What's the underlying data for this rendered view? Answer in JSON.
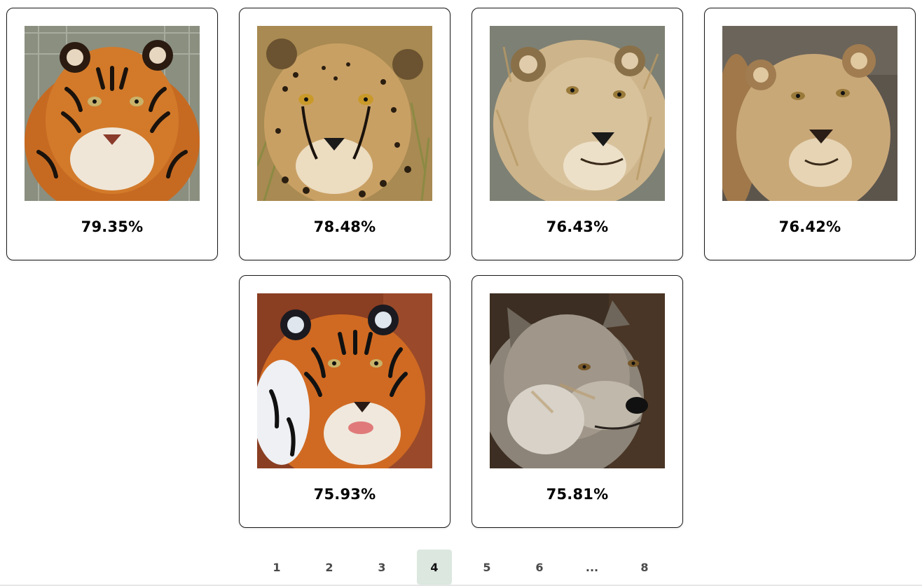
{
  "results": [
    {
      "animal": "tiger",
      "score": "79.35%"
    },
    {
      "animal": "cheetah",
      "score": "78.48%"
    },
    {
      "animal": "lion",
      "score": "76.43%"
    },
    {
      "animal": "lioness",
      "score": "76.42%"
    },
    {
      "animal": "tiger",
      "score": "75.93%"
    },
    {
      "animal": "wolf",
      "score": "75.81%"
    }
  ],
  "pagination": {
    "pages": [
      "1",
      "2",
      "3",
      "4",
      "5",
      "6",
      "...",
      "8"
    ],
    "current": "4"
  },
  "colors": {
    "card_border": "#1a1a1a",
    "active_page_bg": "#dbe7df"
  }
}
